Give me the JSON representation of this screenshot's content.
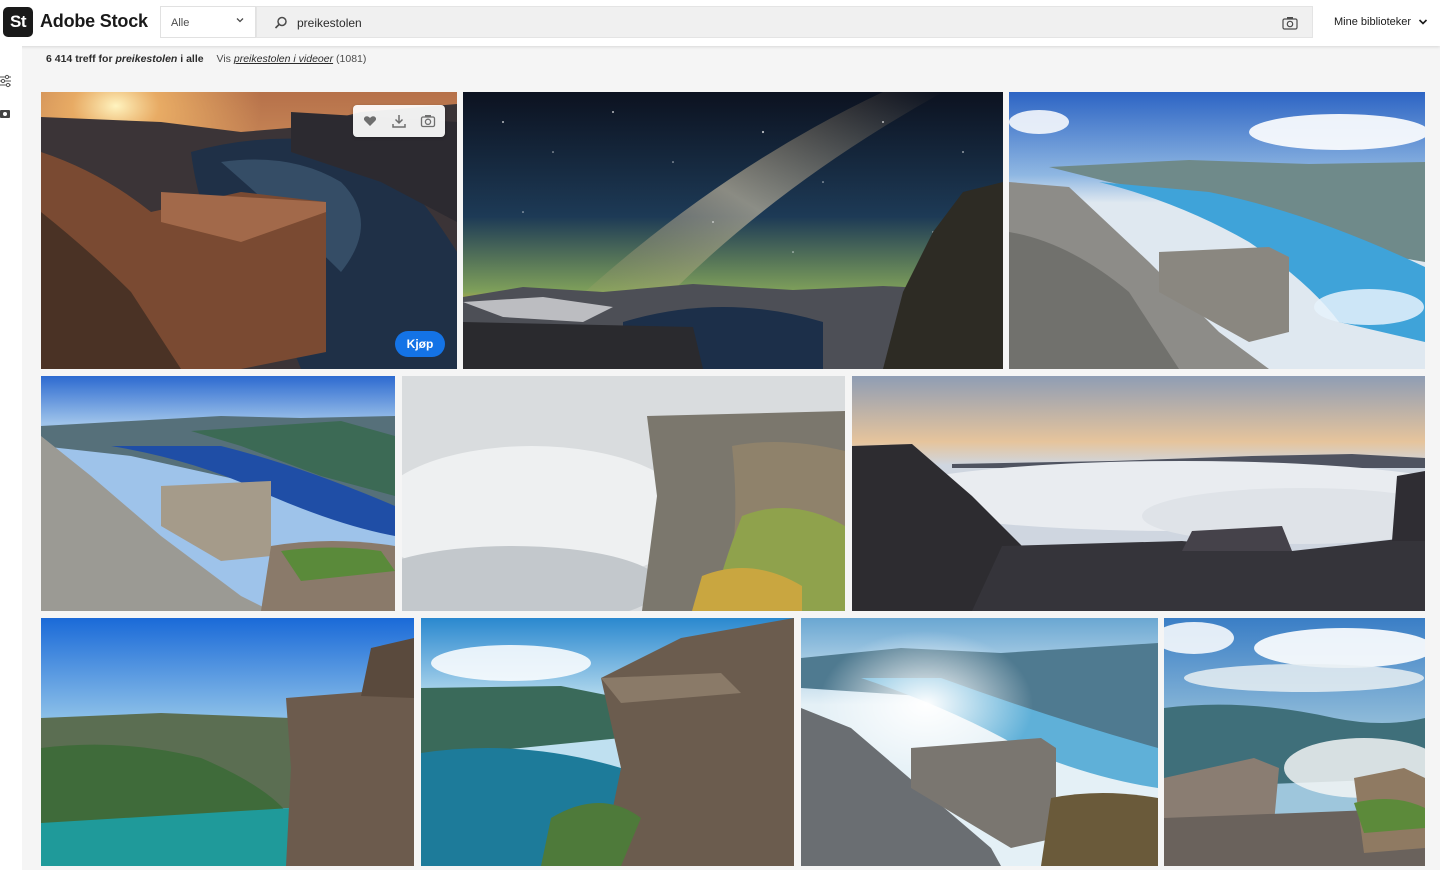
{
  "app": {
    "logo": "St",
    "brand": "Adobe Stock"
  },
  "header": {
    "scope": "Alle",
    "search_value": "preikestolen",
    "libraries": "Mine biblioteker"
  },
  "results": {
    "count": "6 414",
    "text_mid": "treff for",
    "query": "preikestolen",
    "suffix": "i alle",
    "video_prefix": "Vis",
    "video_link": "preikestolen i videoer",
    "video_count": "(1081)"
  },
  "tile_actions": {
    "buy": "Kjøp"
  },
  "icons": {
    "scope": "chevron-down-icon",
    "search": "search-icon",
    "visual_search": "camera-icon",
    "libraries": "chevron-down-icon",
    "rail_filter": "filter-icon",
    "rail_camera": "camera-icon",
    "like": "heart-icon",
    "download": "download-icon",
    "similar": "camera-icon"
  },
  "colors": {
    "accent": "#1473e6",
    "header_bg": "#ffffff",
    "page_bg": "#f5f5f5"
  }
}
